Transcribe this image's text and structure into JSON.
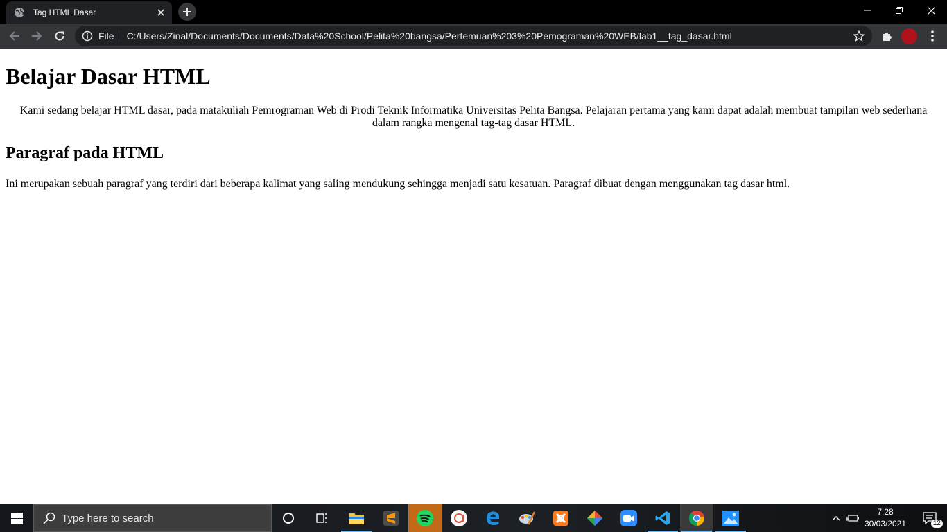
{
  "browser": {
    "tab_title": "Tag HTML Dasar",
    "omnibox_scheme": "File",
    "url": "C:/Users/Zinal/Documents/Documents/Data%20School/Pelita%20bangsa/Pertemuan%203%20Pemograman%20WEB/lab1__tag_dasar.html"
  },
  "page": {
    "heading1": "Belajar Dasar HTML",
    "intro": "Kami sedang belajar HTML dasar, pada matakuliah Pemrograman Web di Prodi Teknik Informatika Universitas Pelita Bangsa. Pelajaran pertama yang kami dapat adalah membuat tampilan web sederhana dalam rangka mengenal tag-tag dasar HTML.",
    "heading2": "Paragraf pada HTML",
    "paragraph": "Ini merupakan sebuah paragraf yang terdiri dari beberapa kalimat yang saling mendukung sehingga menjadi satu kesatuan. Paragraf dibuat dengan menggunakan tag dasar html."
  },
  "taskbar": {
    "search_placeholder": "Type here to search",
    "apps": [
      "file-explorer",
      "sublime-text",
      "spotify",
      "app-a",
      "edge",
      "paint",
      "xampp",
      "git",
      "zoom",
      "vscode",
      "chrome",
      "photos"
    ],
    "time": "7:28",
    "date": "30/03/2021",
    "notification_count": "12"
  }
}
